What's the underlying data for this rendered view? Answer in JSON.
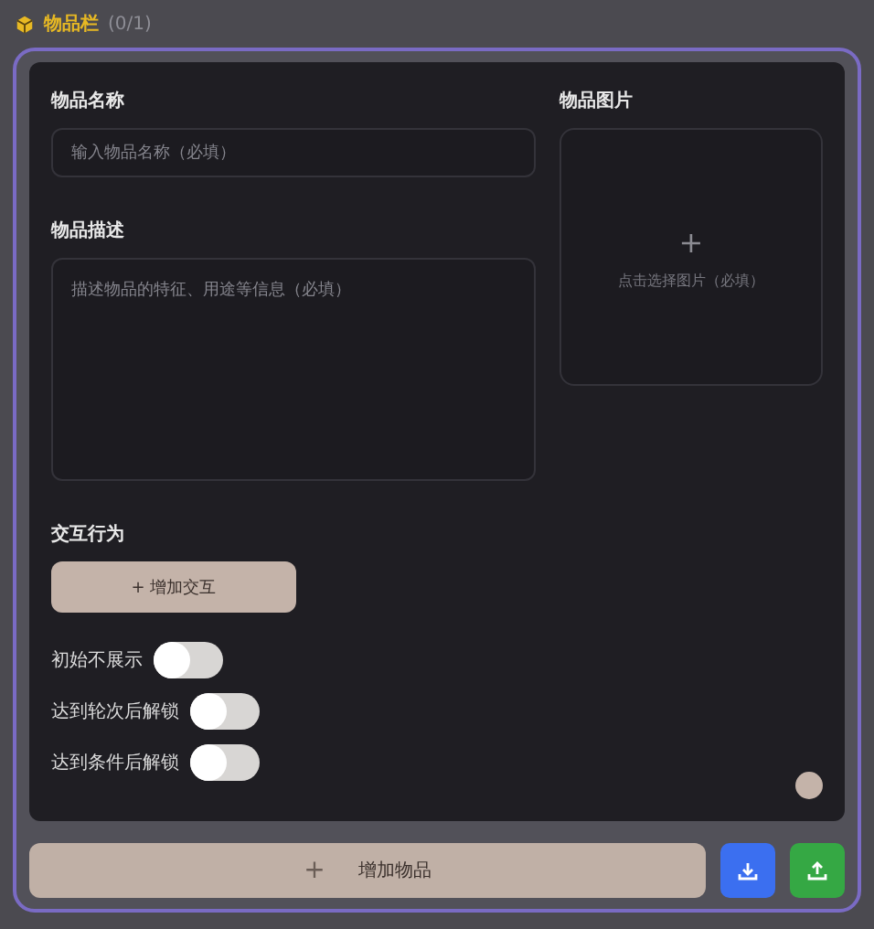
{
  "header": {
    "title": "物品栏",
    "count": "(0/1)"
  },
  "form": {
    "name": {
      "label": "物品名称",
      "placeholder": "输入物品名称（必填）"
    },
    "description": {
      "label": "物品描述",
      "placeholder": "描述物品的特征、用途等信息（必填）"
    },
    "image": {
      "label": "物品图片",
      "plus": "+",
      "hint": "点击选择图片（必填）"
    },
    "interactions": {
      "label": "交互行为",
      "button": "+ 增加交互"
    },
    "toggles": [
      {
        "label": "初始不展示",
        "on": false
      },
      {
        "label": "达到轮次后解锁",
        "on": false
      },
      {
        "label": "达到条件后解锁",
        "on": false
      }
    ]
  },
  "footer": {
    "add_button": {
      "icon": "+",
      "label": "增加物品"
    }
  }
}
